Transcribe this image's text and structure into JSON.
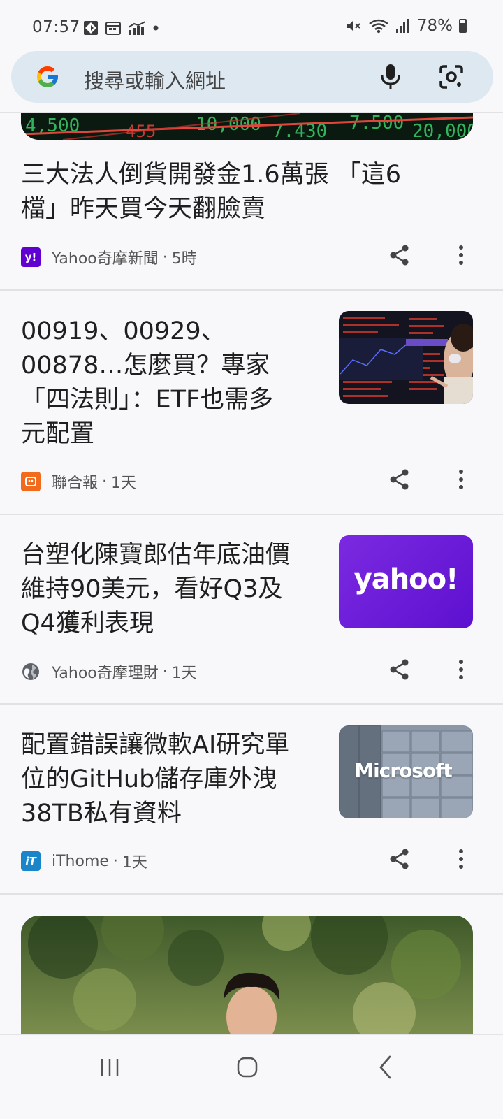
{
  "status": {
    "time": "07:57",
    "battery": "78%"
  },
  "search": {
    "placeholder": "搜尋或輸入網址"
  },
  "articles": [
    {
      "title_lines": [
        "三大法人倒貨開發金1.6萬張 「這6",
        "檔」昨天買今天翻臉賣"
      ],
      "source": "Yahoo奇摩新聞",
      "age": "5時"
    },
    {
      "title_lines": [
        "00919、00929、",
        "00878…怎麼買？專家",
        "「四法則」：ETF也需多",
        "元配置"
      ],
      "source": "聯合報",
      "age": "1天"
    },
    {
      "title_lines": [
        "台塑化陳寶郎估年底油價",
        "維持90美元，看好Q3及",
        "Q4獲利表現"
      ],
      "source": "Yahoo奇摩理財",
      "age": "1天",
      "thumb_text": "yahoo!"
    },
    {
      "title_lines": [
        "配置錯誤讓微軟AI研究單",
        "位的GitHub儲存庫外洩",
        "38TB私有資料"
      ],
      "source": "iThome",
      "age": "1天",
      "thumb_text": "Microsoft"
    }
  ],
  "separator": "·",
  "colors": {
    "yahoo_purple": "#6001d2",
    "udn_orange": "#f26b1d",
    "ithome_blue": "#1a86c9",
    "search_bg": "#dde8f1"
  }
}
